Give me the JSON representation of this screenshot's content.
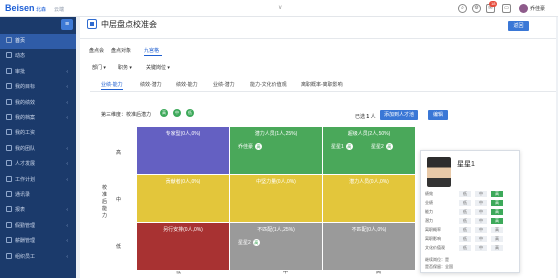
{
  "app": {
    "logo": "Beisen",
    "logo_cn": "北森",
    "logo_tag": "云端"
  },
  "header": {
    "username": "乔佳豪",
    "notif_count": "18",
    "caret": "∨"
  },
  "sidebar": {
    "menu_icon": "≡",
    "items": [
      {
        "label": "首页",
        "icon": "home-icon",
        "arrow": ""
      },
      {
        "label": "动态",
        "icon": "feed-icon",
        "arrow": ""
      },
      {
        "label": "审批",
        "icon": "approval-icon",
        "arrow": "‹"
      },
      {
        "label": "我的目标",
        "icon": "target-icon",
        "arrow": "‹"
      },
      {
        "label": "我的绩效",
        "icon": "performance-icon",
        "arrow": "‹"
      },
      {
        "label": "我的档案",
        "icon": "profile-icon",
        "arrow": "‹"
      },
      {
        "label": "我的工资",
        "icon": "salary-icon",
        "arrow": ""
      },
      {
        "label": "我的团队",
        "icon": "team-icon",
        "arrow": "‹"
      },
      {
        "label": "人才发展",
        "icon": "talent-icon",
        "arrow": "‹"
      },
      {
        "label": "工作计划",
        "icon": "plan-icon",
        "arrow": "‹"
      },
      {
        "label": "通讯录",
        "icon": "contacts-icon",
        "arrow": ""
      },
      {
        "label": "报表",
        "icon": "report-icon",
        "arrow": "‹"
      },
      {
        "label": "假勤管理",
        "icon": "attendance-icon",
        "arrow": "‹"
      },
      {
        "label": "薪酬管理",
        "icon": "compensation-icon",
        "arrow": "‹"
      },
      {
        "label": "组织员工",
        "icon": "org-icon",
        "arrow": "‹"
      }
    ]
  },
  "page": {
    "title": "中层盘点校准会",
    "back_label": "返回"
  },
  "subtabs": [
    {
      "label": "盘点会"
    },
    {
      "label": "盘点对象"
    },
    {
      "label": "九宫格"
    }
  ],
  "filters": [
    {
      "label": "部门 ▾"
    },
    {
      "label": "职务 ▾"
    },
    {
      "label": "关键岗位 ▾"
    }
  ],
  "content_tabs": [
    {
      "label": "业绩-能力"
    },
    {
      "label": "绩效-潜力"
    },
    {
      "label": "绩效-能力"
    },
    {
      "label": "业绩-潜力"
    },
    {
      "label": "能力-文化价值观"
    },
    {
      "label": "离职概率-离职影响"
    }
  ],
  "dimension": {
    "label": "第三维度：校准后潜力",
    "dots": [
      {
        "text": "高",
        "color": "#3da95a"
      },
      {
        "text": "中",
        "color": "#3da95a"
      },
      {
        "text": "低",
        "color": "#3da95a"
      }
    ]
  },
  "toolbar": {
    "selected_prefix": "已选",
    "selected_count": "1",
    "selected_suffix": "人",
    "add_button": "添加到人才池",
    "edit_button": "编辑"
  },
  "grid": {
    "y_axis": "校准后能力",
    "row_labels": [
      "高",
      "中",
      "低"
    ],
    "col_labels": [
      "低",
      "中",
      "高"
    ],
    "cells": [
      {
        "title": "专家型(0人,0%)",
        "color": "#6460c2",
        "people": []
      },
      {
        "title": "潜力人员(1人,25%)",
        "color": "#4aa85a",
        "people": [
          {
            "name": "乔佳豪",
            "tag": "高"
          }
        ]
      },
      {
        "title": "超级人员(2人,50%)",
        "color": "#4aa85a",
        "people": [
          {
            "name": "星星1",
            "tag": "高"
          },
          {
            "name": "星星2",
            "tag": "高"
          }
        ]
      },
      {
        "title": "贡献者(0人,0%)",
        "color": "#e3c63b",
        "people": []
      },
      {
        "title": "中坚力量(0人,0%)",
        "color": "#e3c63b",
        "people": []
      },
      {
        "title": "潜力人员(0人,0%)",
        "color": "#e3c63b",
        "people": []
      },
      {
        "title": "另行安排(0人,0%)",
        "color": "#a83232",
        "people": []
      },
      {
        "title": "不匹配(1人,25%)",
        "color": "#9a9a9a",
        "people": [
          {
            "name": "星星2",
            "tag": "高"
          }
        ]
      },
      {
        "title": "不匹配(0人,0%)",
        "color": "#9a9a9a",
        "people": []
      }
    ]
  },
  "popup": {
    "name": "星星1",
    "rows": [
      {
        "label": "绩效",
        "levels": [
          "低",
          "中",
          "高"
        ],
        "on": 2
      },
      {
        "label": "业绩",
        "levels": [
          "低",
          "中",
          "高"
        ],
        "on": 2
      },
      {
        "label": "能力",
        "levels": [
          "低",
          "中",
          "高"
        ],
        "on": 2
      },
      {
        "label": "潜力",
        "levels": [
          "低",
          "中",
          "高"
        ],
        "on": 2
      },
      {
        "label": "离职概率",
        "levels": [
          "低",
          "中",
          "高"
        ],
        "on": -1
      },
      {
        "label": "离职影响",
        "levels": [
          "低",
          "中",
          "高"
        ],
        "on": -1
      },
      {
        "label": "文化价值观",
        "levels": [
          "低",
          "中",
          "高"
        ],
        "on": -1
      }
    ],
    "key_position_label": "继续岗位：",
    "key_position_value": "是",
    "stay_label": "是否保留：",
    "stay_value": "全国"
  }
}
